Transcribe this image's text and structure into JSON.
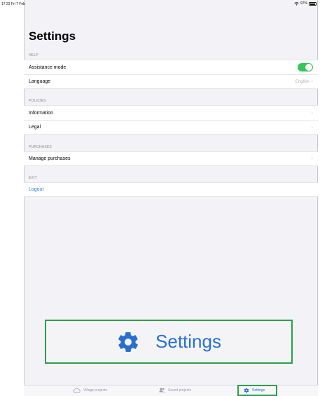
{
  "status_bar": {
    "time": "17:22 Fri 7 Feb",
    "battery": "97%"
  },
  "title": "Settings",
  "sections": {
    "help": {
      "header": "HELP",
      "assistance_label": "Assistance mode",
      "assistance_on": true,
      "language_label": "Language",
      "language_value": "English"
    },
    "policies": {
      "header": "POLICIES",
      "information_label": "Information",
      "legal_label": "Legal"
    },
    "purchases": {
      "header": "PURCHASES",
      "manage_label": "Manage purchases"
    },
    "exit": {
      "header": "EXIT",
      "logout_label": "Logout"
    }
  },
  "callout": {
    "label": "Settings",
    "icon": "gear-icon"
  },
  "tabbar": {
    "village_label": "Village projects",
    "saved_label": "Saved projects",
    "settings_label": "Settings",
    "active": "settings"
  },
  "colors": {
    "accent": "#2a6fd0",
    "toggle_on": "#34c759",
    "highlight": "#2e9e4a"
  }
}
